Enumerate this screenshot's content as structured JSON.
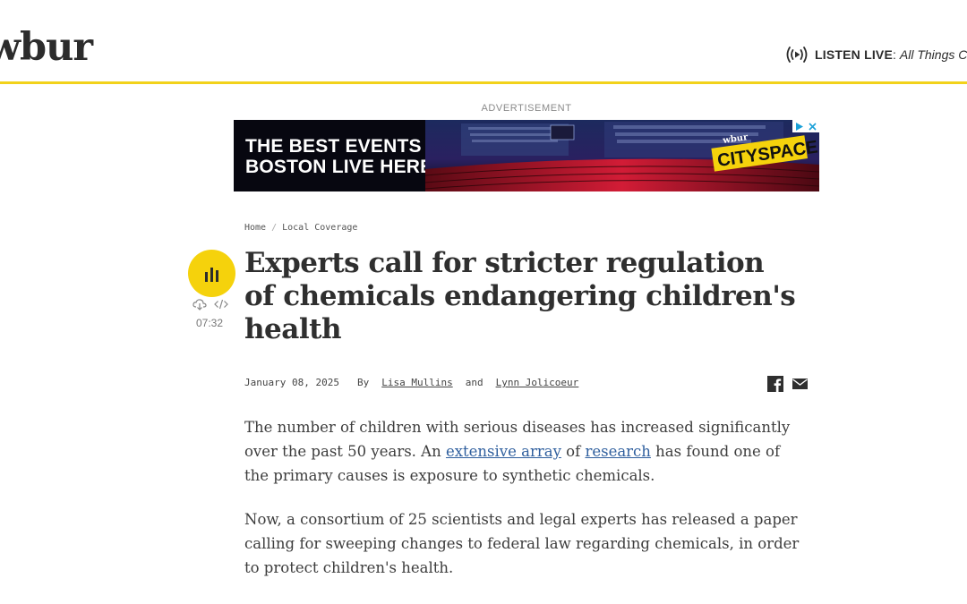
{
  "header": {
    "logo": "wbur",
    "listen_live_label": "LISTEN LIVE",
    "listen_live_separator": ":",
    "listen_live_show": "All Things Co"
  },
  "ad": {
    "label": "ADVERTISEMENT",
    "headline_line1": "THE BEST EVENTS IN",
    "headline_line2": "BOSTON LIVE HERE.",
    "brand_small": "wbur",
    "brand_big": "CITYSPACE"
  },
  "breadcrumb": {
    "home": "Home",
    "separator": "/",
    "section": "Local Coverage"
  },
  "audio": {
    "duration": "07:32"
  },
  "article": {
    "headline": "Experts call for stricter regulation of chemicals endangering children's health",
    "date": "January 08, 2025",
    "by": "By",
    "author1": "Lisa Mullins",
    "and": "and",
    "author2": "Lynn Jolicoeur",
    "p1_a": "The number of children with serious diseases has increased significantly over the past 50 years. An ",
    "p1_link1": "extensive array",
    "p1_b": " of ",
    "p1_link2": "research",
    "p1_c": " has found one of the primary causes is exposure to synthetic chemicals.",
    "p2": "Now, a consortium of 25 scientists and legal experts has released a paper calling for sweeping changes to federal law regarding chemicals, in order to protect children's health."
  },
  "colors": {
    "accent_yellow": "#f5d20c",
    "header_rule": "#f2d21b",
    "link_blue": "#2f5f9e",
    "ad_background": "#070710"
  }
}
